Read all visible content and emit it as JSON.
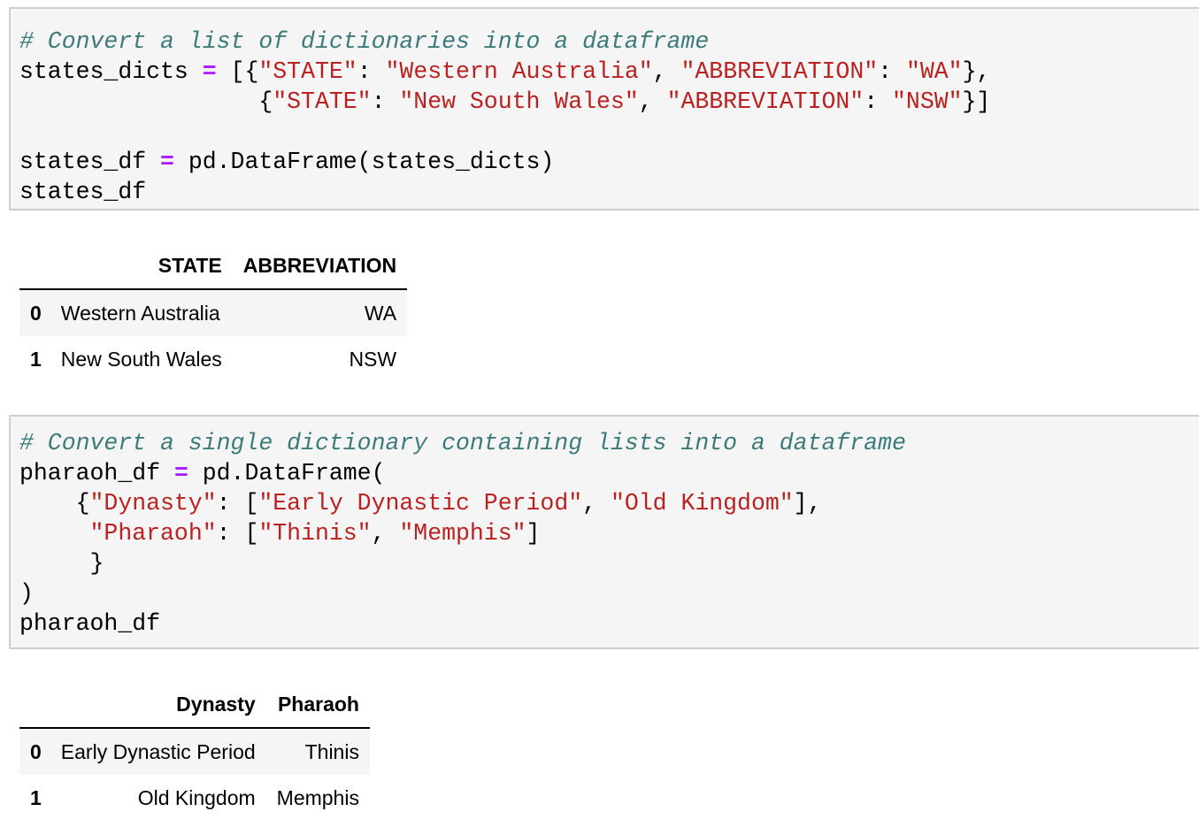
{
  "cell1": {
    "comment": "# Convert a list of dictionaries into a dataframe",
    "var_states_dicts": "states_dicts",
    "eq": "=",
    "open1": " [{",
    "key_state": "\"STATE\"",
    "colon": ": ",
    "val_wa_full": "\"Western Australia\"",
    "comma_sp": ", ",
    "key_abbrev": "\"ABBREVIATION\"",
    "val_wa": "\"WA\"",
    "close1": "},",
    "indent2": "                 {",
    "val_nsw_full": "\"New South Wales\"",
    "val_nsw": "\"NSW\"",
    "close2": "}]",
    "var_states_df": "states_df",
    "call": " pd.DataFrame(states_dicts)",
    "last_line": "states_df"
  },
  "table1": {
    "columns": [
      "STATE",
      "ABBREVIATION"
    ],
    "rows": [
      {
        "index": "0",
        "STATE": "Western Australia",
        "ABBREVIATION": "WA"
      },
      {
        "index": "1",
        "STATE": "New South Wales",
        "ABBREVIATION": "NSW"
      }
    ]
  },
  "cell2": {
    "comment": "# Convert a single dictionary containing lists into a dataframe",
    "var_pharaoh_df": "pharaoh_df",
    "eq": "=",
    "call_open": " pd.DataFrame(",
    "l2_indent": "    {",
    "key_dynasty": "\"Dynasty\"",
    "colon_open": ": [",
    "val_early": "\"Early Dynastic Period\"",
    "comma_sp": ", ",
    "val_old": "\"Old Kingdom\"",
    "l2_end": "],",
    "l3_indent": "     ",
    "key_pharaoh": "\"Pharaoh\"",
    "val_thinis": "\"Thinis\"",
    "val_memphis": "\"Memphis\"",
    "l3_end": "]",
    "l4": "     }",
    "l5": ")",
    "last_line": "pharaoh_df"
  },
  "table2": {
    "columns": [
      "Dynasty",
      "Pharaoh"
    ],
    "rows": [
      {
        "index": "0",
        "Dynasty": "Early Dynastic Period",
        "Pharaoh": "Thinis"
      },
      {
        "index": "1",
        "Dynasty": "Old Kingdom",
        "Pharaoh": "Memphis"
      }
    ]
  }
}
